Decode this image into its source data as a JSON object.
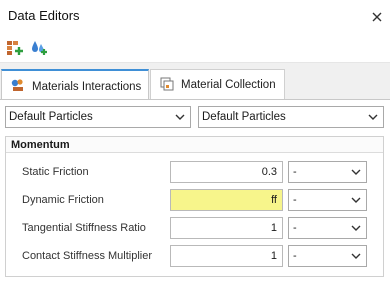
{
  "window": {
    "title": "Data Editors"
  },
  "toolbar": {
    "buttons": [
      {
        "name": "add-material-icon"
      },
      {
        "name": "add-particle-icon"
      }
    ]
  },
  "tabs": [
    {
      "label": "Materials Interactions",
      "active": true,
      "icon": "materials-interactions-icon"
    },
    {
      "label": "Material Collection",
      "active": false,
      "icon": "material-collection-icon"
    }
  ],
  "selectors": {
    "left": {
      "value": "Default Particles"
    },
    "right": {
      "value": "Default Particles"
    }
  },
  "momentum": {
    "title": "Momentum",
    "rows": [
      {
        "label": "Static Friction",
        "value": "0.3",
        "unit": "-",
        "highlight": false
      },
      {
        "label": "Dynamic Friction",
        "value": "ff",
        "unit": "-",
        "highlight": true
      },
      {
        "label": "Tangential Stiffness Ratio",
        "value": "1",
        "unit": "-",
        "highlight": false
      },
      {
        "label": "Contact Stiffness Multiplier",
        "value": "1",
        "unit": "-",
        "highlight": false
      }
    ]
  },
  "colors": {
    "highlight": "#f7f58b",
    "active_tab_accent": "#3f8fd6"
  }
}
